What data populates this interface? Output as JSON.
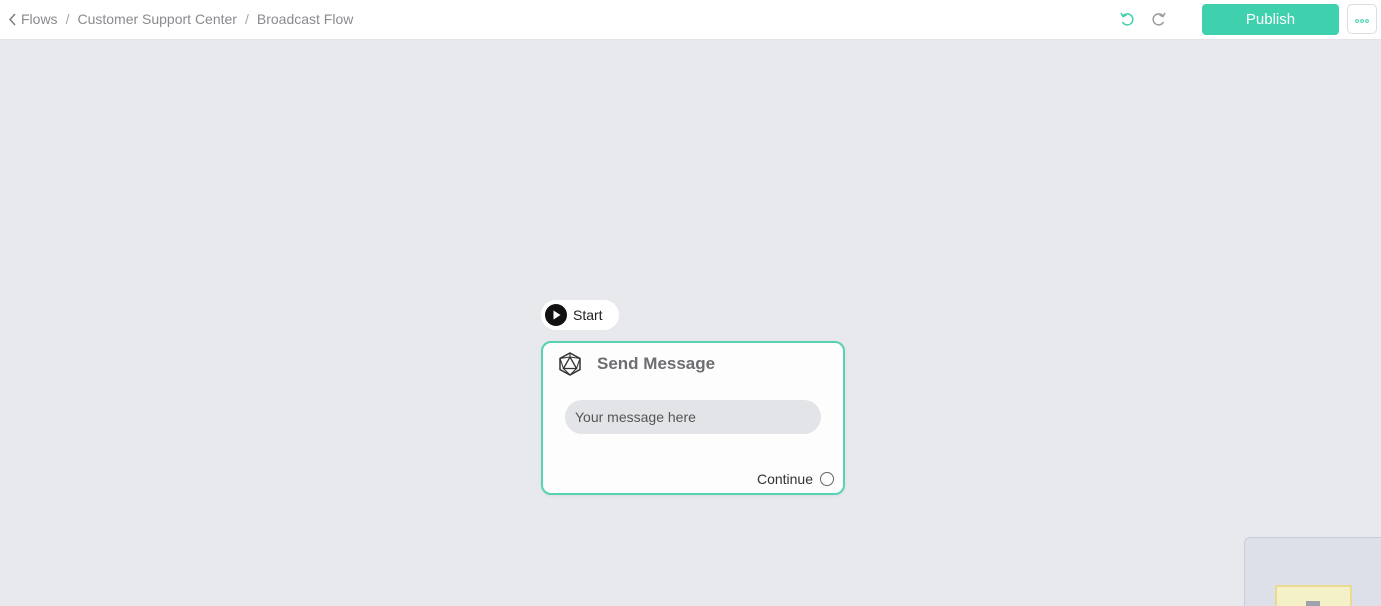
{
  "breadcrumb": {
    "items": [
      "Flows",
      "Customer Support Center",
      "Broadcast Flow"
    ],
    "separator": "/"
  },
  "toolbar": {
    "publish_label": "Publish",
    "accent_color": "#3fd1ae"
  },
  "icons": {
    "back": "chevron-left-icon",
    "undo": "undo-icon",
    "redo": "redo-icon",
    "more": "more-horizontal-icon",
    "start": "play-icon",
    "node": "hexagon-box-icon"
  },
  "flow": {
    "start_label": "Start",
    "node": {
      "title": "Send Message",
      "message_placeholder": "Your message here",
      "continue_label": "Continue",
      "border_color": "#55d3b3"
    }
  }
}
